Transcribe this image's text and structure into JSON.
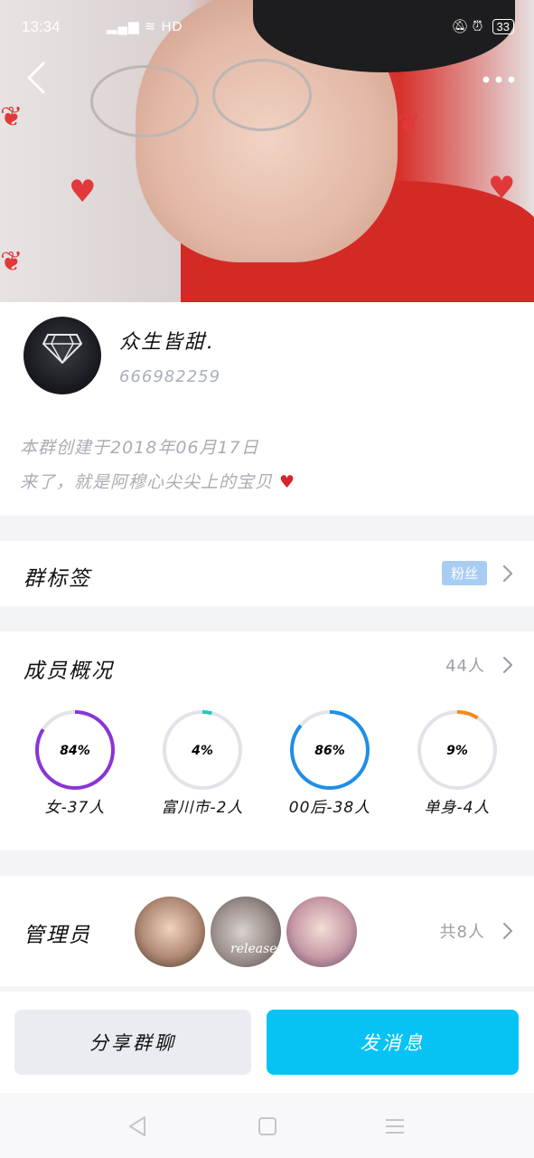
{
  "status_bar": {
    "time": "13:34",
    "network": "HD",
    "battery": "33"
  },
  "profile": {
    "group_name": "众生皆甜.",
    "group_id": "666982259",
    "created_text": "本群创建于2018年06月17日",
    "motto": "来了，就是阿穆心尖尖上的宝贝"
  },
  "group_tag": {
    "title": "群标签",
    "tag": "粉丝"
  },
  "members": {
    "title": "成员概况",
    "count": "44人",
    "stats": [
      {
        "percent_text": "84%",
        "percent": 84,
        "label": "女-37人",
        "color": "#8a35d6"
      },
      {
        "percent_text": "4%",
        "percent": 4,
        "label": "富川市-2人",
        "color": "#25c8b8"
      },
      {
        "percent_text": "86%",
        "percent": 86,
        "label": "00后-38人",
        "color": "#1f8fe6"
      },
      {
        "percent_text": "9%",
        "percent": 9,
        "label": "单身-4人",
        "color": "#f08a1f"
      }
    ]
  },
  "admins": {
    "title": "管理员",
    "count": "共8人",
    "avatar_2_text": "release"
  },
  "actions": {
    "share": "分享群聊",
    "send": "发消息"
  },
  "colors": {
    "primary": "#07c3f5",
    "tag_bg": "#a9cdf2",
    "separator": "#f3f4f7"
  }
}
